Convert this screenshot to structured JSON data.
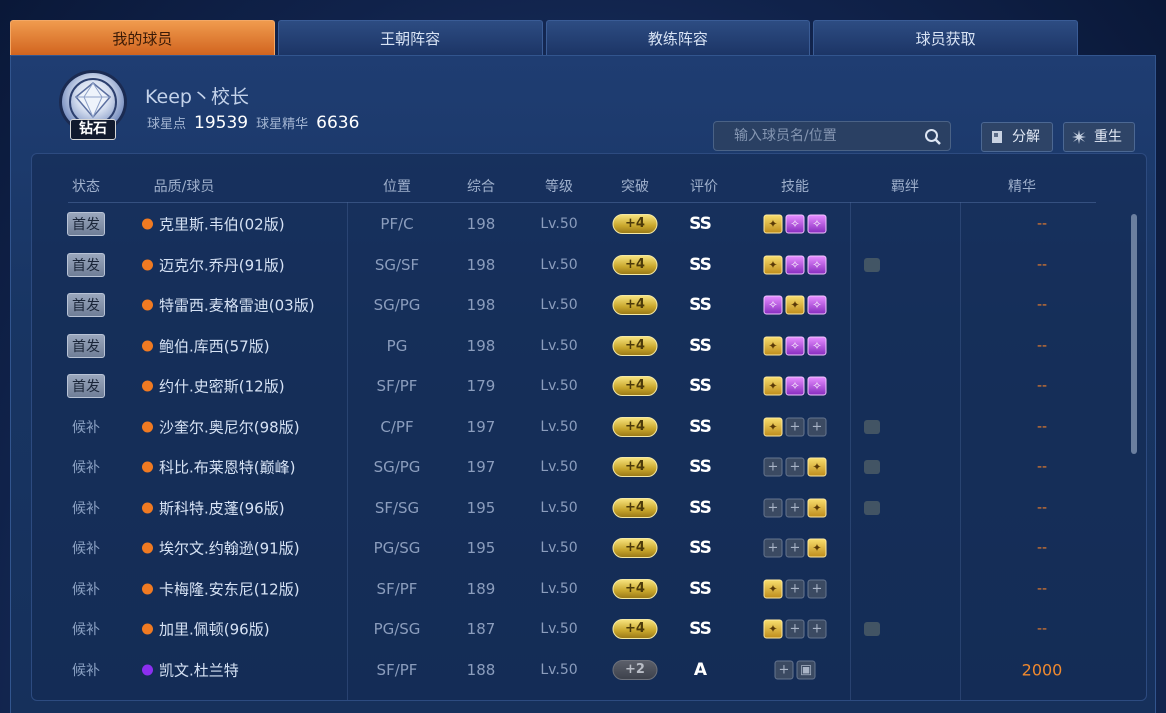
{
  "tabs": [
    "我的球员",
    "王朝阵容",
    "教练阵容",
    "球员获取"
  ],
  "profile": {
    "rank": "钻石",
    "name": "Keep丶校长",
    "stars_label": "球星点",
    "stars": "19539",
    "essence_label": "球星精华",
    "essence": "6636"
  },
  "search": {
    "placeholder": "输入球员名/位置"
  },
  "actions": {
    "decompose": "分解",
    "rebirth": "重生"
  },
  "columns": [
    "状态",
    "品质/球员",
    "位置",
    "综合",
    "等级",
    "突破",
    "评价",
    "技能",
    "羁绊",
    "精华"
  ],
  "colors": {
    "orange_quality": "#f07a22",
    "purple_quality": "#8b2ff0",
    "essence": "#e87d2d"
  },
  "players": [
    {
      "status": "首发",
      "name": "克里斯.韦伯(02版)",
      "quality": "orange",
      "pos": "PF/C",
      "ovr": "198",
      "lvl": "Lv.50",
      "brk": "+4",
      "rate": "SS",
      "skills": [
        "gold",
        "purple",
        "purple"
      ],
      "bond": false,
      "ess": "--"
    },
    {
      "status": "首发",
      "name": "迈克尔.乔丹(91版)",
      "quality": "orange",
      "pos": "SG/SF",
      "ovr": "198",
      "lvl": "Lv.50",
      "brk": "+4",
      "rate": "SS",
      "skills": [
        "gold",
        "purple",
        "purple"
      ],
      "bond": true,
      "ess": "--"
    },
    {
      "status": "首发",
      "name": "特雷西.麦格雷迪(03版)",
      "quality": "orange",
      "pos": "SG/PG",
      "ovr": "198",
      "lvl": "Lv.50",
      "brk": "+4",
      "rate": "SS",
      "skills": [
        "purple",
        "gold",
        "purple"
      ],
      "bond": false,
      "ess": "--"
    },
    {
      "status": "首发",
      "name": "鲍伯.库西(57版)",
      "quality": "orange",
      "pos": "PG",
      "ovr": "198",
      "lvl": "Lv.50",
      "brk": "+4",
      "rate": "SS",
      "skills": [
        "gold",
        "purple",
        "purple"
      ],
      "bond": false,
      "ess": "--"
    },
    {
      "status": "首发",
      "name": "约什.史密斯(12版)",
      "quality": "orange",
      "pos": "SF/PF",
      "ovr": "179",
      "lvl": "Lv.50",
      "brk": "+4",
      "rate": "SS",
      "skills": [
        "gold",
        "purple",
        "purple"
      ],
      "bond": false,
      "ess": "--"
    },
    {
      "status": "候补",
      "name": "沙奎尔.奥尼尔(98版)",
      "quality": "orange",
      "pos": "C/PF",
      "ovr": "197",
      "lvl": "Lv.50",
      "brk": "+4",
      "rate": "SS",
      "skills": [
        "gold",
        "empty",
        "empty"
      ],
      "bond": true,
      "ess": "--"
    },
    {
      "status": "候补",
      "name": "科比.布莱恩特(巅峰)",
      "quality": "orange",
      "pos": "SG/PG",
      "ovr": "197",
      "lvl": "Lv.50",
      "brk": "+4",
      "rate": "SS",
      "skills": [
        "empty",
        "empty",
        "gold"
      ],
      "bond": true,
      "ess": "--"
    },
    {
      "status": "候补",
      "name": "斯科特.皮蓬(96版)",
      "quality": "orange",
      "pos": "SF/SG",
      "ovr": "195",
      "lvl": "Lv.50",
      "brk": "+4",
      "rate": "SS",
      "skills": [
        "empty",
        "empty",
        "gold"
      ],
      "bond": true,
      "ess": "--"
    },
    {
      "status": "候补",
      "name": "埃尔文.约翰逊(91版)",
      "quality": "orange",
      "pos": "PG/SG",
      "ovr": "195",
      "lvl": "Lv.50",
      "brk": "+4",
      "rate": "SS",
      "skills": [
        "empty",
        "empty",
        "gold"
      ],
      "bond": false,
      "ess": "--"
    },
    {
      "status": "候补",
      "name": "卡梅隆.安东尼(12版)",
      "quality": "orange",
      "pos": "SF/PF",
      "ovr": "189",
      "lvl": "Lv.50",
      "brk": "+4",
      "rate": "SS",
      "skills": [
        "gold",
        "empty",
        "empty"
      ],
      "bond": false,
      "ess": "--"
    },
    {
      "status": "候补",
      "name": "加里.佩顿(96版)",
      "quality": "orange",
      "pos": "PG/SG",
      "ovr": "187",
      "lvl": "Lv.50",
      "brk": "+4",
      "rate": "SS",
      "skills": [
        "gold",
        "empty",
        "empty"
      ],
      "bond": true,
      "ess": "--"
    },
    {
      "status": "候补",
      "name": "凯文.杜兰特",
      "quality": "purple",
      "pos": "SF/PF",
      "ovr": "188",
      "lvl": "Lv.50",
      "brk": "+2",
      "rate": "A",
      "skills": [
        "empty",
        "lock"
      ],
      "bond": false,
      "ess": "2000"
    }
  ]
}
